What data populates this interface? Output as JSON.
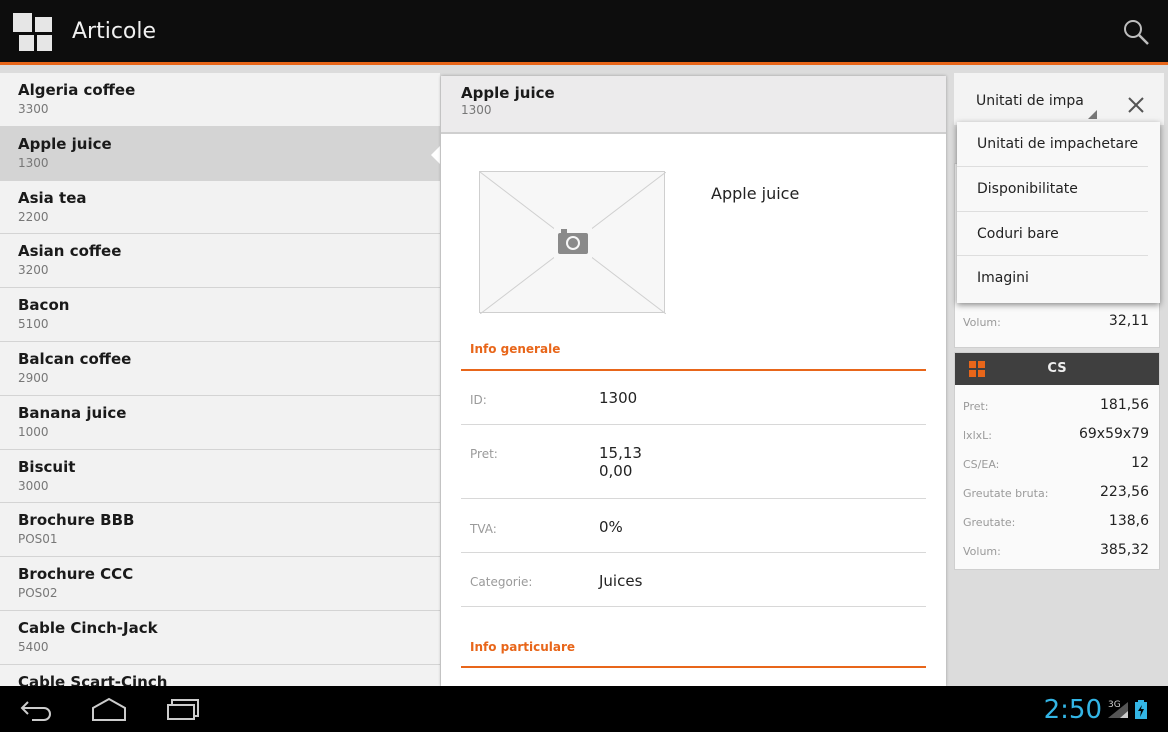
{
  "app": {
    "title": "Articole",
    "icons": {
      "app": "app-grid-icon",
      "search": "search-icon"
    }
  },
  "articles": [
    {
      "name": "Algeria coffee",
      "code": "3300"
    },
    {
      "name": "Apple juice",
      "code": "1300"
    },
    {
      "name": "Asia tea",
      "code": "2200"
    },
    {
      "name": "Asian coffee",
      "code": "3200"
    },
    {
      "name": "Bacon",
      "code": "5100"
    },
    {
      "name": "Balcan coffee",
      "code": "2900"
    },
    {
      "name": "Banana juice",
      "code": "1000"
    },
    {
      "name": "Biscuit",
      "code": "3000"
    },
    {
      "name": "Brochure BBB",
      "code": "POS01"
    },
    {
      "name": "Brochure CCC",
      "code": "POS02"
    },
    {
      "name": "Cable Cinch-Jack",
      "code": "5400"
    },
    {
      "name": "Cable Scart-Cinch",
      "code": ""
    }
  ],
  "selected_index": 1,
  "detail": {
    "name": "Apple juice",
    "code": "1300",
    "product_title": "Apple juice",
    "photo_icon": "camera-icon",
    "section_general": "Info generale",
    "section_particular": "Info particulare",
    "rows": {
      "id": {
        "label": "ID:",
        "value": "1300"
      },
      "price": {
        "label": "Pret:",
        "value1": "15,13",
        "value2": "0,00"
      },
      "vat": {
        "label": "TVA:",
        "value": "0%"
      },
      "category": {
        "label": "Categorie:",
        "value": "Juices"
      }
    }
  },
  "units_panel": {
    "spinner_value": "Unitati de impa",
    "close_icon": "close-icon",
    "menu_options": [
      "Unitati de impachetare",
      "Disponibilitate",
      "Coduri bare",
      "Imagini"
    ],
    "card1": {
      "volume_label": "Volum:",
      "volume_value": "32,11"
    },
    "card2": {
      "title": "CS",
      "icon": "units-grid-icon",
      "rows": [
        {
          "label": "Pret:",
          "value": "181,56"
        },
        {
          "label": "lxlxL:",
          "value": "69x59x79"
        },
        {
          "label": "CS/EA:",
          "value": "12"
        },
        {
          "label": "Greutate bruta:",
          "value": "223,56"
        },
        {
          "label": "Greutate:",
          "value": "138,6"
        },
        {
          "label": "Volum:",
          "value": "385,32"
        }
      ]
    }
  },
  "system_bar": {
    "clock": "2:50",
    "network": "3G",
    "icons": [
      "back-icon",
      "home-icon",
      "recent-apps-icon",
      "signal-icon",
      "battery-icon"
    ]
  },
  "colors": {
    "accent": "#e8661a",
    "clock": "#33b5e5",
    "action_bar": "#0d0d0d"
  }
}
